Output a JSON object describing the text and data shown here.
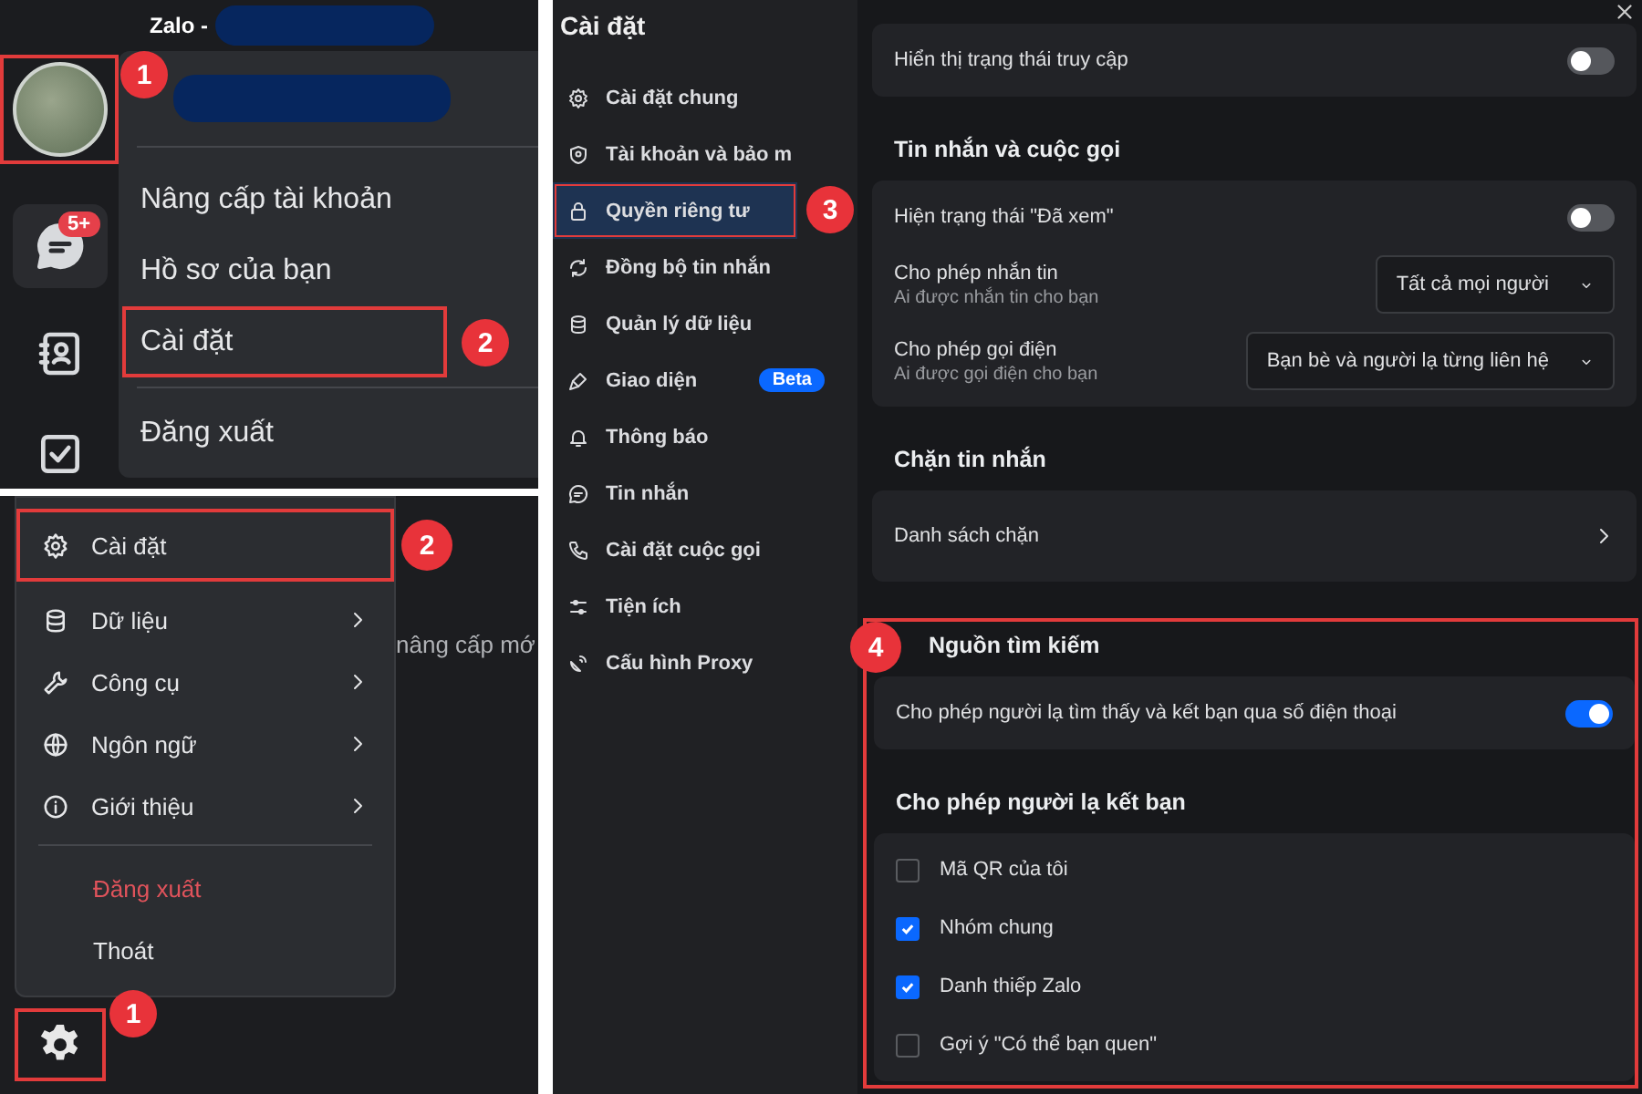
{
  "profile_menu_panel": {
    "title": "Zalo - ",
    "avatar": {
      "highlighted": true,
      "step": "1"
    },
    "chat_badge": "5+",
    "menu": [
      {
        "label": "Nâng cấp tài khoản",
        "highlighted": false
      },
      {
        "label": "Hồ sơ của bạn",
        "highlighted": false
      },
      {
        "label": "Cài đặt",
        "highlighted": true,
        "step": "2"
      },
      {
        "label": "Đăng xuất",
        "highlighted": false
      }
    ]
  },
  "gear_menu_panel": {
    "background_text": "nâng cấp mớ",
    "menu": [
      {
        "label": "Cài đặt",
        "kind": "item",
        "submenu": false,
        "highlighted": true,
        "step": "2"
      },
      {
        "label": "Dữ liệu",
        "kind": "item",
        "submenu": true,
        "highlighted": false
      },
      {
        "label": "Công cụ",
        "kind": "item",
        "submenu": true,
        "highlighted": false
      },
      {
        "label": "Ngôn ngữ",
        "kind": "item",
        "submenu": true,
        "highlighted": false
      },
      {
        "label": "Giới thiệu",
        "kind": "item",
        "submenu": true,
        "highlighted": false
      },
      {
        "label": "Đăng xuất",
        "kind": "danger",
        "submenu": false,
        "highlighted": false
      },
      {
        "label": "Thoát",
        "kind": "plain",
        "submenu": false,
        "highlighted": false
      }
    ],
    "settings_button": {
      "highlighted": true,
      "step": "1"
    }
  },
  "settings_window": {
    "title": "Cài đặt",
    "sidebar": [
      {
        "label": "Cài đặt chung",
        "selected": false,
        "highlighted": false
      },
      {
        "label": "Tài khoản và bảo m",
        "selected": false,
        "highlighted": false
      },
      {
        "label": "Quyền riêng tư",
        "selected": true,
        "highlighted": true,
        "step": "3"
      },
      {
        "label": "Đồng bộ tin nhắn",
        "selected": false,
        "highlighted": false
      },
      {
        "label": "Quản lý dữ liệu",
        "selected": false,
        "highlighted": false
      },
      {
        "label": "Giao diện",
        "selected": false,
        "highlighted": false,
        "badge": "Beta"
      },
      {
        "label": "Thông báo",
        "selected": false,
        "highlighted": false
      },
      {
        "label": "Tin nhắn",
        "selected": false,
        "highlighted": false
      },
      {
        "label": "Cài đặt cuộc gọi",
        "selected": false,
        "highlighted": false
      },
      {
        "label": "Tiện ích",
        "selected": false,
        "highlighted": false
      },
      {
        "label": "Cấu hình Proxy",
        "selected": false,
        "highlighted": false
      }
    ],
    "sections": [
      {
        "rows": [
          {
            "kind": "toggle",
            "label": "Hiển thị trạng thái truy cập",
            "on": false
          }
        ]
      },
      {
        "title": "Tin nhắn và cuộc gọi",
        "rows": [
          {
            "kind": "toggle",
            "label": "Hiện trạng thái \"Đã xem\"",
            "on": false
          },
          {
            "kind": "select",
            "label": "Cho phép nhắn tin",
            "hint": "Ai được nhắn tin cho bạn",
            "value": "Tất cả mọi người"
          },
          {
            "kind": "select",
            "label": "Cho phép gọi điện",
            "hint": "Ai được gọi điện cho bạn",
            "value": "Bạn bè và người lạ từng liên hệ"
          }
        ]
      },
      {
        "title": "Chặn tin nhắn",
        "rows": [
          {
            "kind": "link",
            "label": "Danh sách chặn"
          }
        ]
      }
    ],
    "highlight_box": {
      "step": "4",
      "sections": [
        {
          "title": "Nguồn tìm kiếm",
          "rows": [
            {
              "kind": "toggle",
              "label": "Cho phép người lạ tìm thấy và kết bạn qua số điện thoại",
              "on": true
            }
          ]
        },
        {
          "title": "Cho phép người lạ kết bạn",
          "rows": [
            {
              "kind": "checkbox",
              "label": "Mã QR của tôi",
              "checked": false
            },
            {
              "kind": "checkbox",
              "label": "Nhóm chung",
              "checked": true
            },
            {
              "kind": "checkbox",
              "label": "Danh thiếp Zalo",
              "checked": true
            },
            {
              "kind": "checkbox",
              "label": "Gợi ý \"Có thể bạn quen\"",
              "checked": false
            }
          ]
        }
      ]
    }
  }
}
